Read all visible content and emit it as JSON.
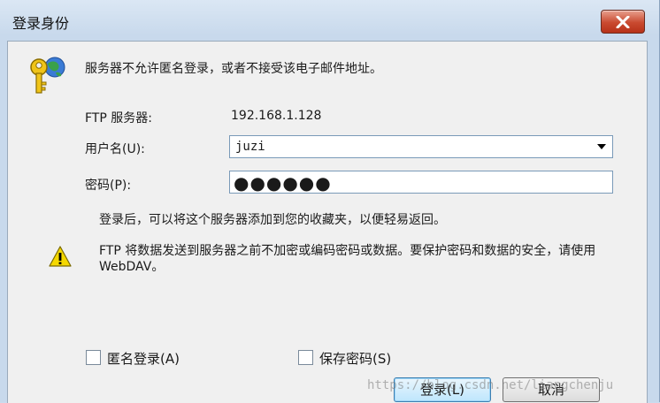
{
  "window": {
    "title": "登录身份",
    "close_label": "关闭"
  },
  "message": "服务器不允许匿名登录，或者不接受该电子邮件地址。",
  "form": {
    "server_label": "FTP 服务器:",
    "server_value": "192.168.1.128",
    "username_label": "用户名(U):",
    "username_value": "juzi",
    "password_label": "密码(P):",
    "password_value": "●●●●●●"
  },
  "note": "登录后，可以将这个服务器添加到您的收藏夹，以便轻易返回。",
  "warning": "FTP 将数据发送到服务器之前不加密或编码密码或数据。要保护密码和数据的安全，请使用 WebDAV。",
  "checkboxes": {
    "anonymous_label": "匿名登录(A)",
    "anonymous_checked": false,
    "save_password_label": "保存密码(S)",
    "save_password_checked": false
  },
  "buttons": {
    "login_label": "登录(L)",
    "cancel_label": "取消"
  },
  "watermark": "https://blog.csdn.net/liangchenju",
  "colors": {
    "titlebar": "#dbe7f4",
    "client_bg": "#f0f0f0",
    "close_button": "#c9492f",
    "warning_yellow": "#f5d800"
  }
}
